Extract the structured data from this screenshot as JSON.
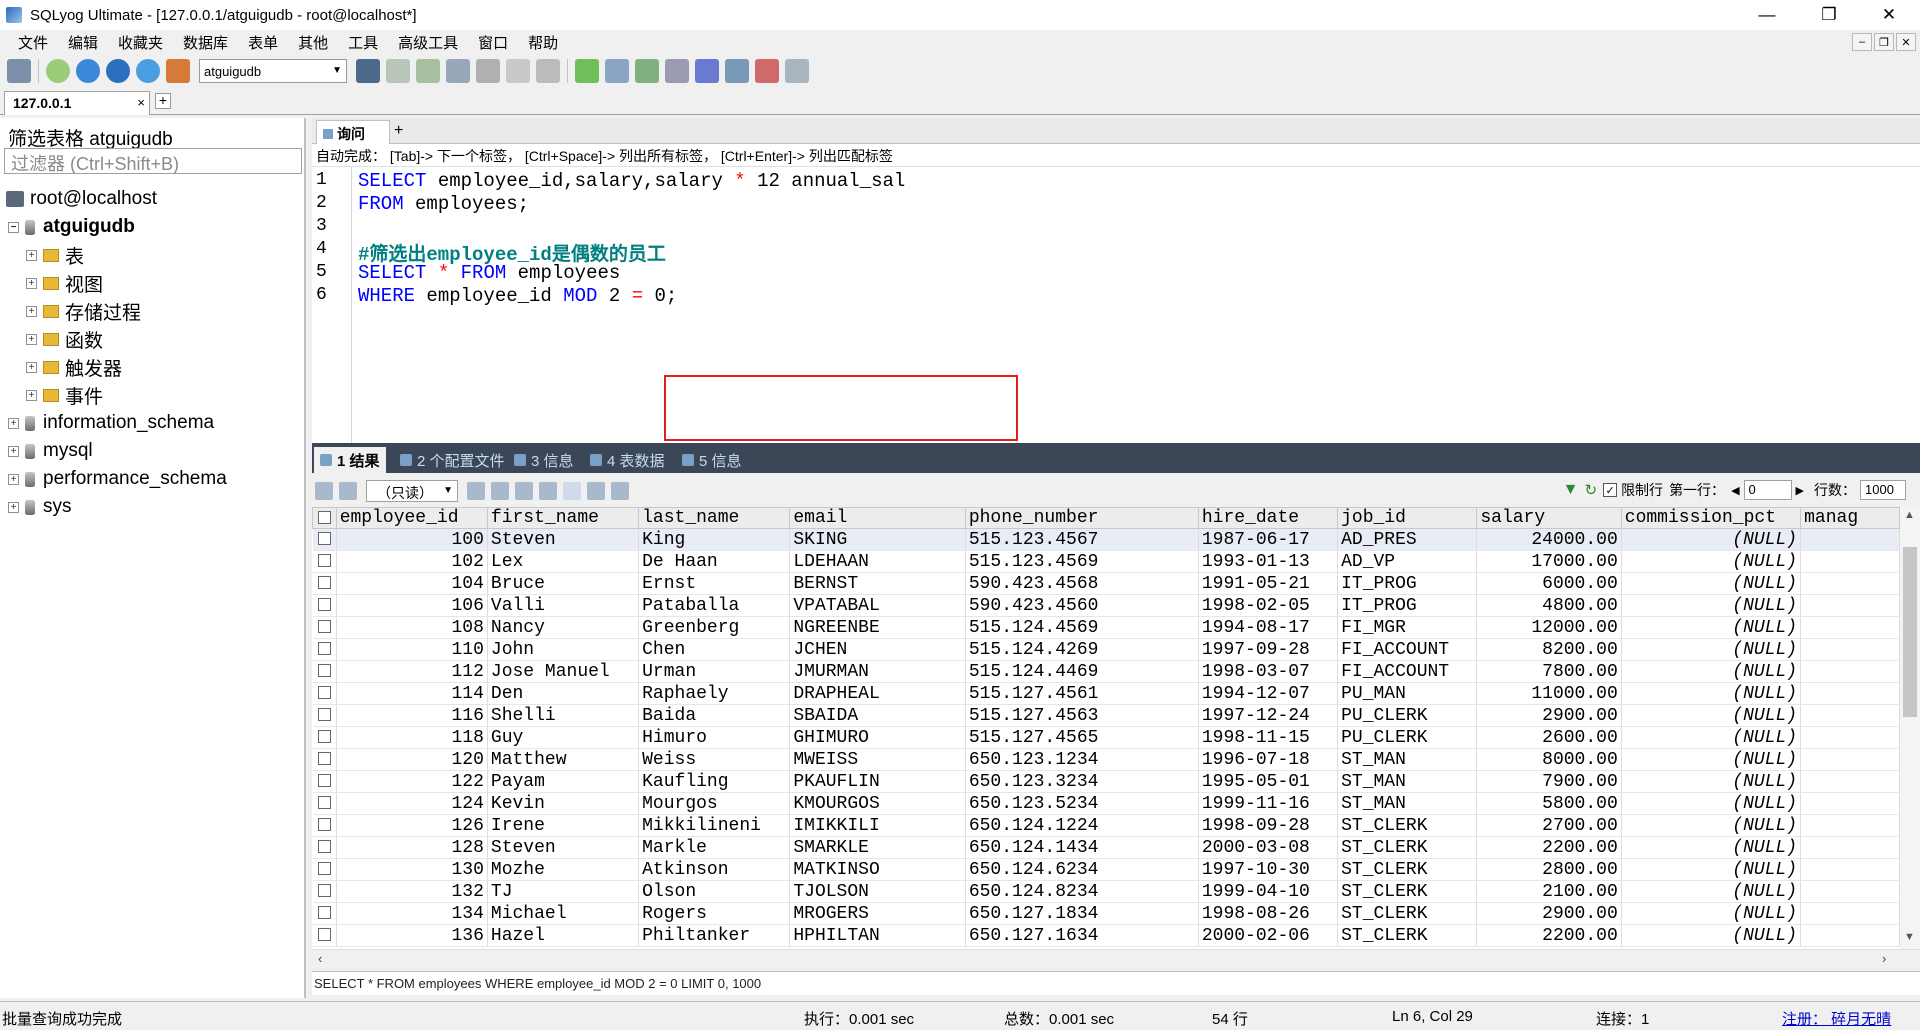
{
  "window": {
    "title": "SQLyog Ultimate - [127.0.0.1/atguigudb - root@localhost*]",
    "minimize": "—",
    "restore": "❐",
    "close": "✕"
  },
  "menu": [
    "文件",
    "编辑",
    "收藏夹",
    "数据库",
    "表单",
    "其他",
    "工具",
    "高级工具",
    "窗口",
    "帮助"
  ],
  "toolbar": {
    "database_select": "atguigudb"
  },
  "connection_tab": {
    "label": "127.0.0.1",
    "close": "×",
    "add": "+"
  },
  "sidebar": {
    "filter_label": "筛选表格 atguigudb",
    "filter_placeholder": "过滤器 (Ctrl+Shift+B)",
    "root": "root@localhost",
    "current_db": "atguigudb",
    "db_children": [
      "表",
      "视图",
      "存储过程",
      "函数",
      "触发器",
      "事件"
    ],
    "other_dbs": [
      "information_schema",
      "mysql",
      "performance_schema",
      "sys"
    ]
  },
  "editor": {
    "tab_label": "询问",
    "autocomplete_hint": "自动完成：  [Tab]-> 下一个标签，  [Ctrl+Space]-> 列出所有标签，  [Ctrl+Enter]-> 列出匹配标签",
    "lines": [
      [
        {
          "t": "SELECT",
          "c": "kw"
        },
        {
          "t": " employee_id,salary,salary ",
          "c": ""
        },
        {
          "t": "*",
          "c": "op"
        },
        {
          "t": " 12 annual_sal",
          "c": ""
        }
      ],
      [
        {
          "t": "FROM",
          "c": "kw"
        },
        {
          "t": " employees;",
          "c": ""
        }
      ],
      [],
      [
        {
          "t": "#筛选出employee_id是偶数的员工",
          "c": "cm"
        }
      ],
      [
        {
          "t": "SELECT",
          "c": "kw"
        },
        {
          "t": " ",
          "c": ""
        },
        {
          "t": "*",
          "c": "op"
        },
        {
          "t": " ",
          "c": ""
        },
        {
          "t": "FROM",
          "c": "kw"
        },
        {
          "t": " employees",
          "c": ""
        }
      ],
      [
        {
          "t": "WHERE",
          "c": "kw"
        },
        {
          "t": " employee_id ",
          "c": ""
        },
        {
          "t": "MOD",
          "c": "kw"
        },
        {
          "t": " 2 ",
          "c": ""
        },
        {
          "t": "=",
          "c": "op"
        },
        {
          "t": " 0;",
          "c": ""
        }
      ]
    ]
  },
  "result_tabs": [
    "1 结果",
    "2 个配置文件",
    "3 信息",
    "4 表数据",
    "5 信息"
  ],
  "result_toolbar": {
    "mode": "（只读）",
    "limit_label": "限制行",
    "first_row_label": "第一行：",
    "first_row": "0",
    "rows_label": "行数：",
    "rows": "1000"
  },
  "grid": {
    "columns": [
      "employee_id",
      "first_name",
      "last_name",
      "email",
      "phone_number",
      "hire_date",
      "job_id",
      "salary",
      "commission_pct",
      "manag"
    ],
    "rows": [
      [
        "100",
        "Steven",
        "King",
        "SKING",
        "515.123.4567",
        "1987-06-17",
        "AD_PRES",
        "24000.00",
        "(NULL)"
      ],
      [
        "102",
        "Lex",
        "De Haan",
        "LDEHAAN",
        "515.123.4569",
        "1993-01-13",
        "AD_VP",
        "17000.00",
        "(NULL)"
      ],
      [
        "104",
        "Bruce",
        "Ernst",
        "BERNST",
        "590.423.4568",
        "1991-05-21",
        "IT_PROG",
        "6000.00",
        "(NULL)"
      ],
      [
        "106",
        "Valli",
        "Pataballa",
        "VPATABAL",
        "590.423.4560",
        "1998-02-05",
        "IT_PROG",
        "4800.00",
        "(NULL)"
      ],
      [
        "108",
        "Nancy",
        "Greenberg",
        "NGREENBE",
        "515.124.4569",
        "1994-08-17",
        "FI_MGR",
        "12000.00",
        "(NULL)"
      ],
      [
        "110",
        "John",
        "Chen",
        "JCHEN",
        "515.124.4269",
        "1997-09-28",
        "FI_ACCOUNT",
        "8200.00",
        "(NULL)"
      ],
      [
        "112",
        "Jose Manuel",
        "Urman",
        "JMURMAN",
        "515.124.4469",
        "1998-03-07",
        "FI_ACCOUNT",
        "7800.00",
        "(NULL)"
      ],
      [
        "114",
        "Den",
        "Raphaely",
        "DRAPHEAL",
        "515.127.4561",
        "1994-12-07",
        "PU_MAN",
        "11000.00",
        "(NULL)"
      ],
      [
        "116",
        "Shelli",
        "Baida",
        "SBAIDA",
        "515.127.4563",
        "1997-12-24",
        "PU_CLERK",
        "2900.00",
        "(NULL)"
      ],
      [
        "118",
        "Guy",
        "Himuro",
        "GHIMURO",
        "515.127.4565",
        "1998-11-15",
        "PU_CLERK",
        "2600.00",
        "(NULL)"
      ],
      [
        "120",
        "Matthew",
        "Weiss",
        "MWEISS",
        "650.123.1234",
        "1996-07-18",
        "ST_MAN",
        "8000.00",
        "(NULL)"
      ],
      [
        "122",
        "Payam",
        "Kaufling",
        "PKAUFLIN",
        "650.123.3234",
        "1995-05-01",
        "ST_MAN",
        "7900.00",
        "(NULL)"
      ],
      [
        "124",
        "Kevin",
        "Mourgos",
        "KMOURGOS",
        "650.123.5234",
        "1999-11-16",
        "ST_MAN",
        "5800.00",
        "(NULL)"
      ],
      [
        "126",
        "Irene",
        "Mikkilineni",
        "IMIKKILI",
        "650.124.1224",
        "1998-09-28",
        "ST_CLERK",
        "2700.00",
        "(NULL)"
      ],
      [
        "128",
        "Steven",
        "Markle",
        "SMARKLE",
        "650.124.1434",
        "2000-03-08",
        "ST_CLERK",
        "2200.00",
        "(NULL)"
      ],
      [
        "130",
        "Mozhe",
        "Atkinson",
        "MATKINSO",
        "650.124.6234",
        "1997-10-30",
        "ST_CLERK",
        "2800.00",
        "(NULL)"
      ],
      [
        "132",
        "TJ",
        "Olson",
        "TJOLSON",
        "650.124.8234",
        "1999-04-10",
        "ST_CLERK",
        "2100.00",
        "(NULL)"
      ],
      [
        "134",
        "Michael",
        "Rogers",
        "MROGERS",
        "650.127.1834",
        "1998-08-26",
        "ST_CLERK",
        "2900.00",
        "(NULL)"
      ],
      [
        "136",
        "Hazel",
        "Philtanker",
        "HPHILTAN",
        "650.127.1634",
        "2000-02-06",
        "ST_CLERK",
        "2200.00",
        "(NULL)"
      ]
    ]
  },
  "sql_status": "SELECT * FROM employees WHERE employee_id MOD 2 = 0 LIMIT 0, 1000",
  "statusbar": {
    "message": "批量查询成功完成",
    "exec": "执行：0.001 sec",
    "total": "总数：0.001 sec",
    "rows": "54 行",
    "position": "Ln 6, Col 29",
    "connections": "连接：1",
    "registered": "注册：  碎月无晴"
  }
}
